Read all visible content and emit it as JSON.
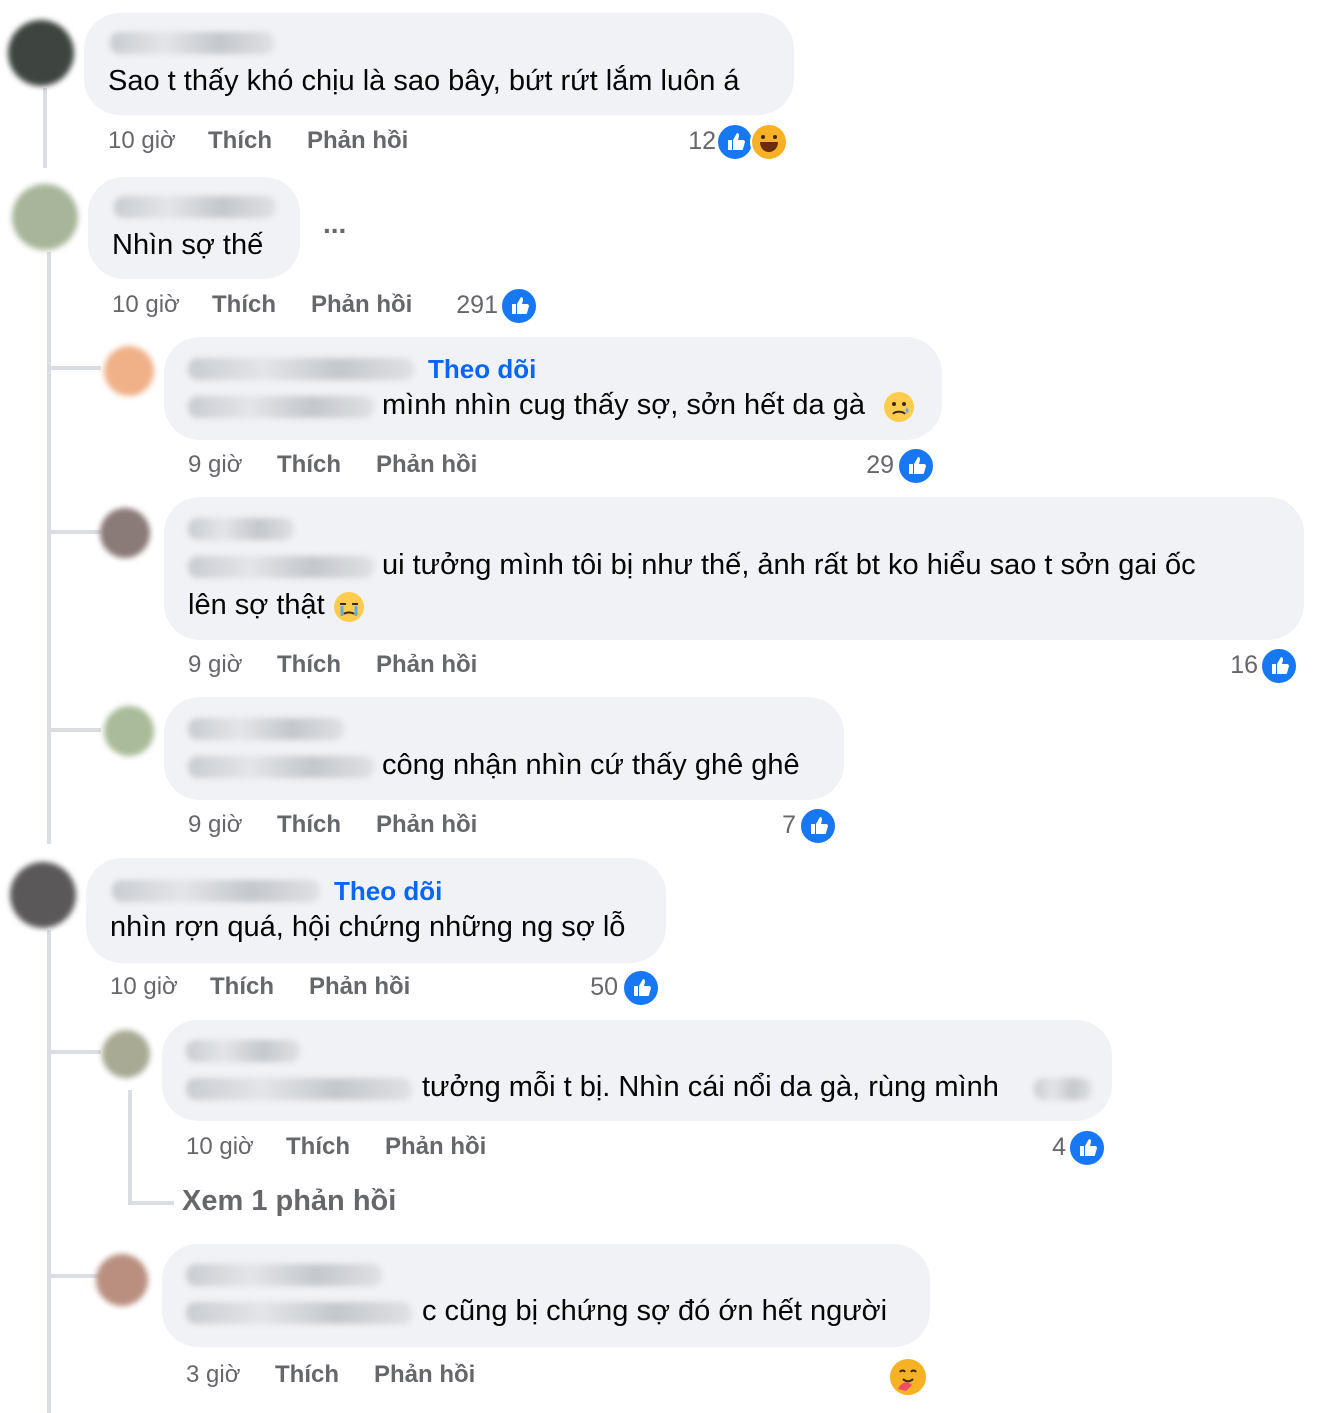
{
  "comments": [
    {
      "name": "Tony Nguyễn",
      "text": "Sao t thấy khó chịu là sao bây, bứt rứt lắm luôn á",
      "time": "10 giờ",
      "like": "Thích",
      "reply": "Phản hồi",
      "reactions": "12"
    },
    {
      "name": "Minh Long Vu",
      "text": "Nhìn sợ thế",
      "more": "...",
      "time": "10 giờ",
      "like": "Thích",
      "reply": "Phản hồi",
      "reactions": "291",
      "replies": [
        {
          "name": "Đinh Thanh Hằng",
          "follow": "Theo dõi",
          "mention": "Minh Long Vu",
          "text": "mình nhìn cug thấy sợ, sởn hết da gà",
          "time": "9 giờ",
          "like": "Thích",
          "reply": "Phản hồi",
          "reactions": "29"
        },
        {
          "name": "Hiếu Tín",
          "mention": "Minh Long Vu",
          "text": "ui tưởng mình tôi bị như thế, ảnh rất bt ko hiểu sao t sởn gai ốc",
          "text2": "lên sợ thật",
          "time": "9 giờ",
          "like": "Thích",
          "reply": "Phản hồi",
          "reactions": "16"
        },
        {
          "name": "Thảo Vũ Đức",
          "mention": "Minh Long Vu",
          "text": "công nhận nhìn cứ thấy ghê ghê",
          "time": "9 giờ",
          "like": "Thích",
          "reply": "Phản hồi",
          "reactions": "7"
        }
      ]
    },
    {
      "name": "Lê Trúc Lan Anh",
      "follow": "Theo dõi",
      "text": "nhìn rợn quá, hội chứng những ng sợ lỗ",
      "time": "10 giờ",
      "like": "Thích",
      "reply": "Phản hồi",
      "reactions": "50",
      "replies": [
        {
          "name": "Hoài Thu",
          "mention": "Lê Trúc Lan Anh",
          "text": "tưởng mỗi t bị. Nhìn cái nổi da gà, rùng mình",
          "time": "10 giờ",
          "like": "Thích",
          "reply": "Phản hồi",
          "reactions": "4",
          "view_replies": "Xem 1 phản hồi"
        },
        {
          "name": "Phương Nguyễn",
          "mention": "Lê Trúc Lan Anh",
          "text": "c cũng bị chứng sợ đó ớn hết người",
          "time": "3 giờ",
          "like": "Thích",
          "reply": "Phản hồi"
        }
      ]
    }
  ],
  "colors": {
    "bubble": "#f0f2f5",
    "meta": "#65676b",
    "follow": "#0866ff",
    "like": "#1877f2"
  },
  "icons": [
    "like-icon",
    "laugh-reaction-icon",
    "crying-emoji-icon",
    "sad-emoji-icon",
    "hug-reaction-icon",
    "more-options-icon"
  ]
}
